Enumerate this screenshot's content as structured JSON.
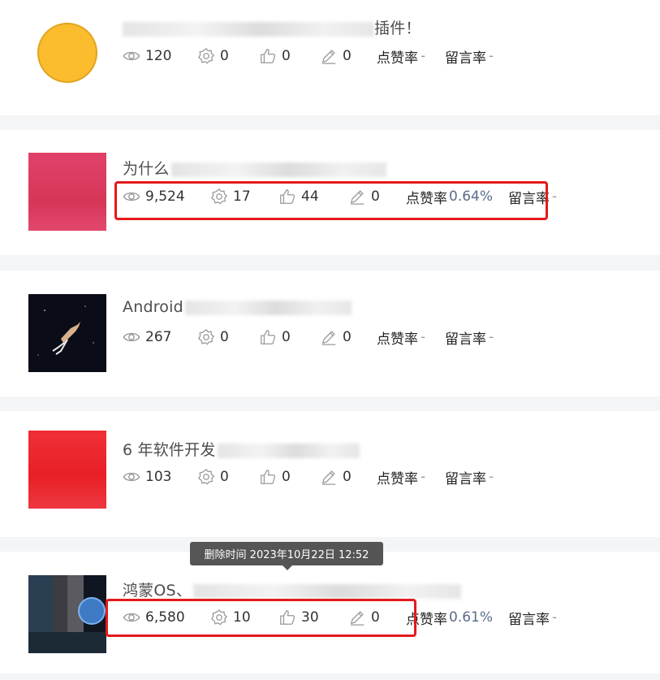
{
  "articles": [
    {
      "title_visible": "",
      "title_tail": "插件！",
      "views": "120",
      "collects": "0",
      "likes": "0",
      "comments": "0",
      "like_rate_label": "点赞率",
      "like_rate_value": "-",
      "comment_rate_label": "留言率",
      "comment_rate_value": "-"
    },
    {
      "title_visible": "为什么",
      "title_tail": "",
      "views": "9,524",
      "collects": "17",
      "likes": "44",
      "comments": "0",
      "like_rate_label": "点赞率",
      "like_rate_value": "0.64%",
      "comment_rate_label": "留言率",
      "comment_rate_value": "-"
    },
    {
      "title_visible": "Android",
      "title_tail": "",
      "views": "267",
      "collects": "0",
      "likes": "0",
      "comments": "0",
      "like_rate_label": "点赞率",
      "like_rate_value": "-",
      "comment_rate_label": "留言率",
      "comment_rate_value": "-"
    },
    {
      "title_visible": "6 年软件开发",
      "title_tail": "",
      "views": "103",
      "collects": "0",
      "likes": "0",
      "comments": "0",
      "like_rate_label": "点赞率",
      "like_rate_value": "-",
      "comment_rate_label": "留言率",
      "comment_rate_value": "-"
    },
    {
      "title_visible": "鸿蒙OS、",
      "title_tail": "",
      "views": "6,580",
      "collects": "10",
      "likes": "30",
      "comments": "0",
      "like_rate_label": "点赞率",
      "like_rate_value": "0.61%",
      "comment_rate_label": "留言率",
      "comment_rate_value": "-"
    }
  ],
  "tooltip": {
    "text": "删除时间 2023年10月22日 12:52"
  },
  "icons": {
    "views": "eye-icon",
    "collects": "gear-icon",
    "likes": "thumbs-up-icon",
    "comments": "pencil-icon"
  },
  "colors": {
    "highlight": "#e5191c",
    "rate_value": "#5b6b8c",
    "avatar_yellow": "#fbbc2e"
  }
}
